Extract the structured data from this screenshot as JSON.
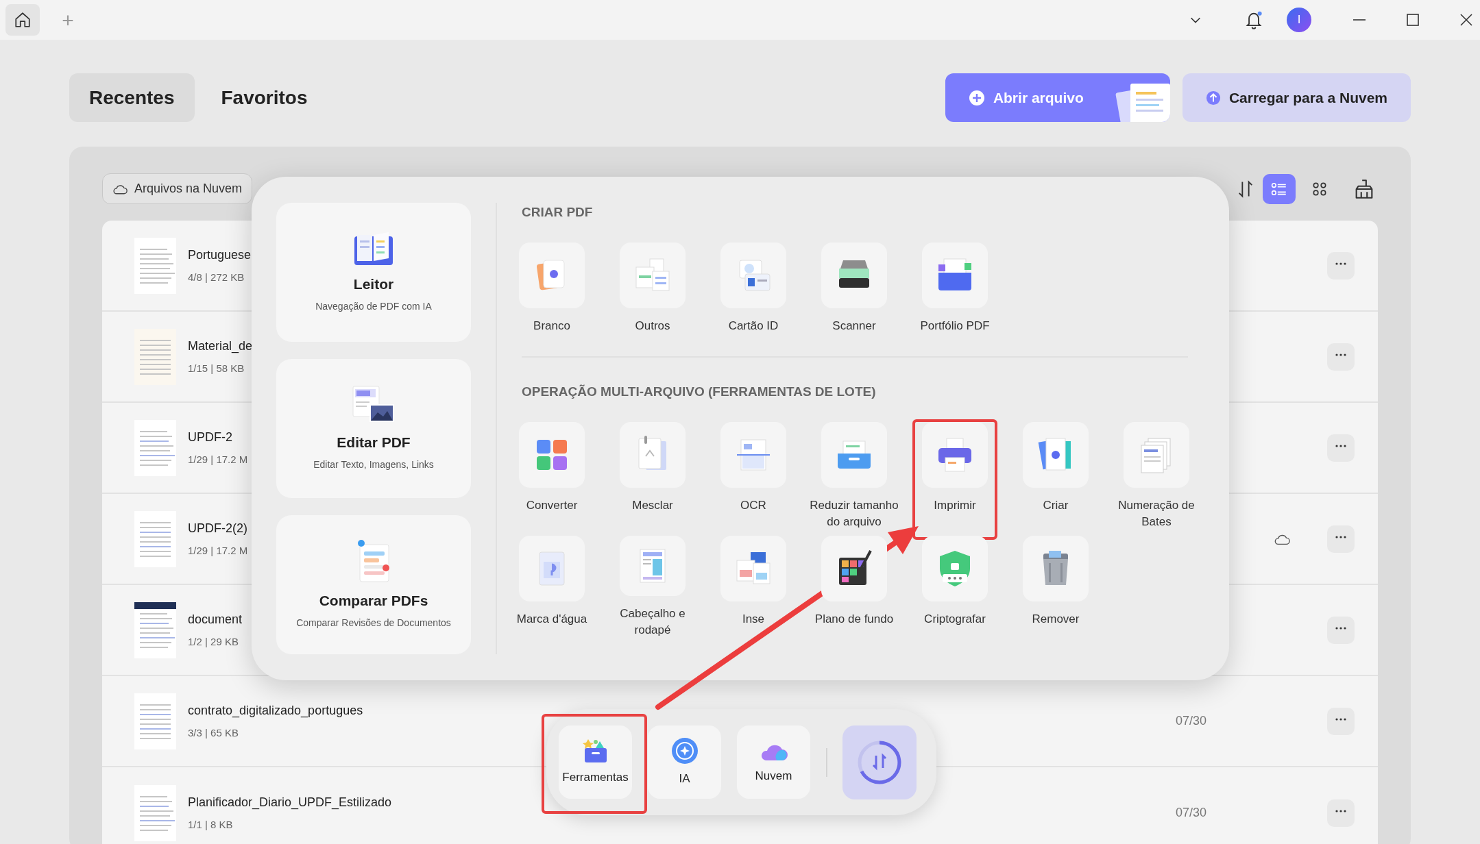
{
  "title_bar": {
    "home_tab": {
      "selected": true
    },
    "new_tab": "+",
    "notification": true,
    "avatar": "I"
  },
  "tabs": [
    {
      "label": "Recentes",
      "selected": true
    },
    {
      "label": "Favoritos",
      "selected": false
    }
  ],
  "actions": [
    {
      "label": "Abrir arquivo",
      "kind": "primary"
    },
    {
      "label": "Carregar para a Nuvem",
      "kind": "secondary"
    }
  ],
  "cloud_filter": {
    "label": "Arquivos na Nuvem"
  },
  "view_modes": [
    {
      "kind": "list",
      "selected": true
    },
    {
      "kind": "grid",
      "selected": false
    }
  ],
  "files": [
    {
      "name": "Portuguese",
      "meta": "4/8 | 272 KB",
      "in_cloud": false
    },
    {
      "name": "Material_de",
      "meta": "1/15 | 58 KB",
      "in_cloud": false
    },
    {
      "name": "UPDF-2",
      "meta": "1/29 | 17.2 M",
      "in_cloud": false
    },
    {
      "name": "UPDF-2(2)",
      "meta": "1/29 | 17.2 M",
      "in_cloud": true
    },
    {
      "name": "document",
      "meta": "1/2 | 29 KB",
      "in_cloud": false
    },
    {
      "name": "contrato_digitalizado_portugues",
      "meta": "3/3 | 65 KB",
      "date": "07/30",
      "in_cloud": false
    },
    {
      "name": "Planificador_Diario_UPDF_Estilizado",
      "meta": "1/1 | 8 KB",
      "date": "07/30",
      "in_cloud": false
    }
  ],
  "tools_popup": {
    "features": [
      {
        "title": "Leitor",
        "subtitle": "Navegação de PDF com IA"
      },
      {
        "title": "Editar PDF",
        "subtitle": "Editar Texto, Imagens, Links"
      },
      {
        "title": "Comparar PDFs",
        "subtitle": "Comparar Revisões de Documentos"
      }
    ],
    "sections": [
      {
        "heading": "CRIAR PDF",
        "tools": [
          {
            "label": "Branco",
            "highlighted": false
          },
          {
            "label": "Outros",
            "highlighted": false
          },
          {
            "label": "Cartão ID",
            "highlighted": false
          },
          {
            "label": "Scanner",
            "highlighted": false
          },
          {
            "label": "Portfólio PDF",
            "highlighted": false
          }
        ]
      },
      {
        "heading": "OPERAÇÃO MULTI-ARQUIVO (FERRAMENTAS DE LOTE)",
        "tools": [
          {
            "label": "Converter",
            "highlighted": false
          },
          {
            "label": "Mesclar",
            "highlighted": false
          },
          {
            "label": "OCR",
            "highlighted": false
          },
          {
            "label": "Reduzir tamanho do arquivo",
            "highlighted": false
          },
          {
            "label": "Imprimir",
            "highlighted": true
          },
          {
            "label": "Criar",
            "highlighted": false
          },
          {
            "label": "Numeração de Bates",
            "highlighted": false
          },
          {
            "label": "Marca d'água",
            "highlighted": false
          },
          {
            "label": "Cabeçalho e rodapé",
            "highlighted": false
          },
          {
            "label": "Inse",
            "highlighted": false
          },
          {
            "label": "Plano de fundo",
            "highlighted": false
          },
          {
            "label": "Criptografar",
            "highlighted": false
          },
          {
            "label": "Remover",
            "highlighted": false
          }
        ]
      }
    ]
  },
  "dock": {
    "items": [
      {
        "label": "Ferramentas",
        "highlighted": true
      },
      {
        "label": "IA",
        "highlighted": false
      },
      {
        "label": "Nuvem",
        "highlighted": false
      }
    ]
  }
}
